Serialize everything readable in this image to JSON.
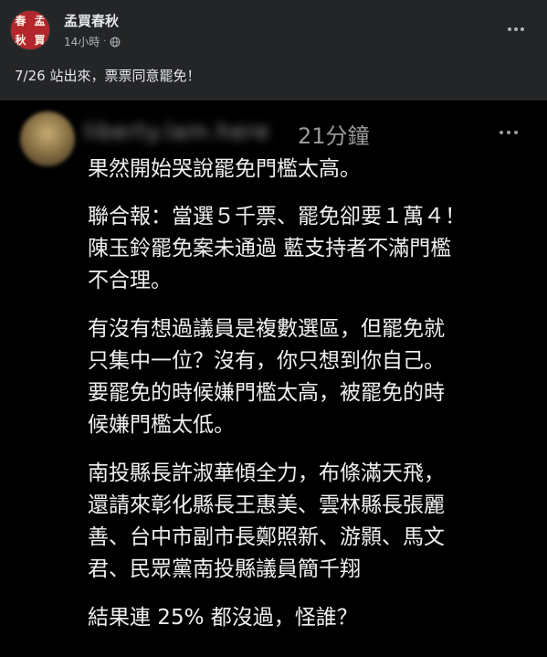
{
  "post": {
    "page_name": "孟買春秋",
    "time": "14小時",
    "separator": "·",
    "caption": "7/26 站出來，票票同意罷免！",
    "avatar_chars": [
      "春",
      "孟",
      "秋",
      "買"
    ]
  },
  "comment": {
    "time": "21分鐘",
    "paragraphs": [
      [
        "果然開始哭說罷免門檻太高。"
      ],
      [
        "聯合報：當選５千票、罷免卻要１萬４！",
        "陳玉鈴罷免案未通過 藍支持者不滿門檻",
        "不合理。"
      ],
      [
        "有沒有想過議員是複數選區，但罷免就",
        "只集中一位？沒有，你只想到你自己。",
        "要罷免的時候嫌門檻太高，被罷免的時",
        "候嫌門檻太低。"
      ],
      [
        "南投縣長許淑華傾全力，布條滿天飛，",
        "還請來彰化縣長王惠美、雲林縣長張麗",
        "善、台中市副市長鄭照新、游顥、馬文",
        "君、民眾黨南投縣議員簡千翔"
      ],
      [
        "結果連 25% 都沒過，怪誰？"
      ]
    ]
  },
  "colors": {
    "background": "#242526",
    "text": "#e4e6eb",
    "secondary": "#b0b3b8",
    "avatar_red": "#b3262b",
    "screenshot_bg": "#000000"
  },
  "icons": {
    "privacy": "globe-icon",
    "more": "more-dots-icon"
  }
}
